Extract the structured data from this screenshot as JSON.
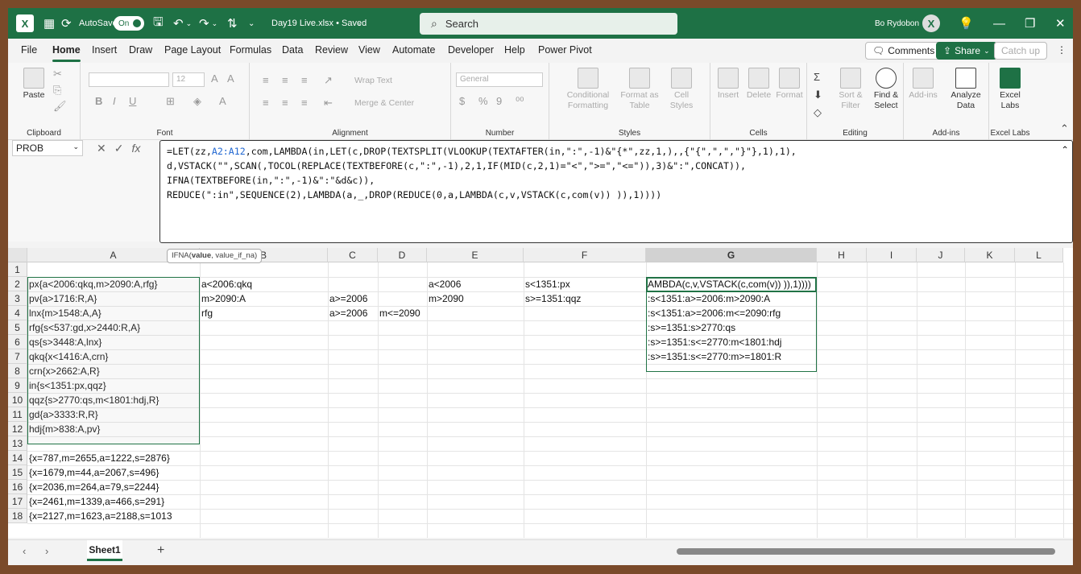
{
  "title_bar": {
    "autosave_label": "AutoSave",
    "autosave_state": "On",
    "document_title": "Day19 Live.xlsx • Saved",
    "search_placeholder": "Search",
    "user_name": "Bo Rydobon",
    "user_initial": "X"
  },
  "menu_tabs": [
    "File",
    "Home",
    "Insert",
    "Draw",
    "Page Layout",
    "Formulas",
    "Data",
    "Review",
    "View",
    "Automate",
    "Developer",
    "Help",
    "Power Pivot"
  ],
  "active_tab": "Home",
  "right_buttons": {
    "comments": "Comments",
    "share": "Share",
    "catchup": "Catch up"
  },
  "ribbon": {
    "clipboard": {
      "label": "Clipboard",
      "paste": "Paste"
    },
    "font": {
      "label": "Font",
      "size": "12"
    },
    "alignment": {
      "label": "Alignment",
      "wrap_text": "Wrap Text",
      "merge_center": "Merge & Center"
    },
    "number": {
      "label": "Number",
      "format": "General"
    },
    "styles": {
      "label": "Styles",
      "conditional": "Conditional Formatting",
      "format_table": "Format as Table",
      "cell_styles": "Cell Styles"
    },
    "cells": {
      "label": "Cells",
      "insert": "Insert",
      "delete": "Delete",
      "format": "Format"
    },
    "editing": {
      "label": "Editing",
      "sort_filter": "Sort & Filter",
      "find_select": "Find & Select"
    },
    "addins": {
      "label": "Add-ins",
      "addins_btn": "Add-ins",
      "analyze": "Analyze Data"
    },
    "excel_labs": {
      "label": "Excel Labs",
      "btn": "Excel Labs"
    }
  },
  "name_box": "PROB",
  "formula_lines": [
    "=LET(zz,|A2:A12|,com,LAMBDA(in,LET(c,DROP(TEXTSPLIT(VLOOKUP(TEXTAFTER(in,\":\",-1)&\"{*\",zz,1,),,{\"{\",\",\",\"}\"},1),1),",
    "d,VSTACK(\"\",SCAN(,TOCOL(REPLACE(TEXTBEFORE(c,\":\",-1),2,1,IF(MID(c,2,1)=\"<\",\">=\",\"<=\")),3)&\":\",CONCAT)),",
    "IFNA(TEXTBEFORE(in,\":\",-1)&\":\"&d&c)),",
    "REDUCE(\":in\",SEQUENCE(2),LAMBDA(a,_,DROP(REDUCE(0,a,LAMBDA(c,v,VSTACK(c,com(v)) )),1))))"
  ],
  "tooltip": {
    "func": "IFNA(",
    "arg1": "value",
    ",rest": ", value_if_na)"
  },
  "columns": [
    "A",
    "B",
    "C",
    "D",
    "E",
    "F",
    "G",
    "H",
    "I",
    "J",
    "K",
    "L"
  ],
  "selected_column": "G",
  "rows": {
    "1": {},
    "2": {
      "A": "px{a<2006:qkq,m>2090:A,rfg}",
      "B": "a<2006:qkq",
      "E": "a<2006",
      "F": "s<1351:px",
      "G": "AMBDA(c,v,VSTACK(c,com(v)) )),1))))"
    },
    "3": {
      "A": "pv{a>1716:R,A}",
      "B": "m>2090:A",
      "C": "a>=2006",
      "E": "m>2090",
      "F": "s>=1351:qqz",
      "G": ":s<1351:a>=2006:m>2090:A"
    },
    "4": {
      "A": "lnx{m>1548:A,A}",
      "B": "rfg",
      "C": "a>=2006",
      "D": "m<=2090",
      "G": ":s<1351:a>=2006:m<=2090:rfg"
    },
    "5": {
      "A": "rfg{s<537:gd,x>2440:R,A}",
      "G": ":s>=1351:s>2770:qs"
    },
    "6": {
      "A": "qs{s>3448:A,lnx}",
      "G": ":s>=1351:s<=2770:m<1801:hdj"
    },
    "7": {
      "A": "qkq{x<1416:A,crn}",
      "G": ":s>=1351:s<=2770:m>=1801:R"
    },
    "8": {
      "A": "crn{x>2662:A,R}"
    },
    "9": {
      "A": "in{s<1351:px,qqz}"
    },
    "10": {
      "A": "qqz{s>2770:qs,m<1801:hdj,R}"
    },
    "11": {
      "A": "gd{a>3333:R,R}"
    },
    "12": {
      "A": "hdj{m>838:A,pv}"
    },
    "13": {},
    "14": {
      "A": "{x=787,m=2655,a=1222,s=2876}"
    },
    "15": {
      "A": "{x=1679,m=44,a=2067,s=496}"
    },
    "16": {
      "A": "{x=2036,m=264,a=79,s=2244}"
    },
    "17": {
      "A": "{x=2461,m=1339,a=466,s=291}"
    },
    "18": {
      "A": "{x=2127,m=1623,a=2188,s=1013"
    }
  },
  "sheet_tabs": [
    "Sheet1"
  ],
  "colors": {
    "brand": "#1e7145",
    "reference": "#1f66d1"
  }
}
